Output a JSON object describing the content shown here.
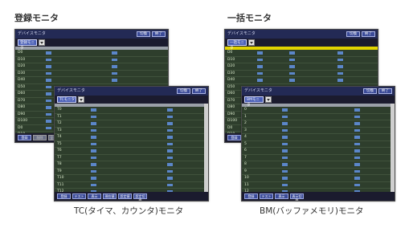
{
  "headings": {
    "registered": "登録モニタ",
    "batch": "一括モニタ"
  },
  "captions": {
    "tc": "TC(タイマ、カウンタ)モニタ",
    "bm": "BM(バッファメモリ)モニタ"
  },
  "window_titles": {
    "device_monitor": "デバイスモニタ"
  },
  "buttons": {
    "switch": "切換",
    "close": "終了"
  },
  "dropdowns": {
    "registered": "登録モニタ",
    "batch": "一括モニタ",
    "tc": "TCモニタ",
    "bm": "BMモニタ"
  },
  "footer_buttons": {
    "registered": [
      "登録",
      "削除",
      "全削除"
    ],
    "tc": [
      "登録",
      "テスト",
      "表示",
      "現在値",
      "設定値",
      "設定切換"
    ],
    "bm": [
      "登録",
      "テスト",
      "表示",
      "表示切換"
    ]
  },
  "row_labels": {
    "registered": [
      "D0",
      "D10",
      "D20",
      "D30",
      "D40",
      "D50",
      "D60",
      "D70",
      "D80",
      "D90",
      "D100"
    ],
    "tc": [
      "T0",
      "T1",
      "T2",
      "T3",
      "T4",
      "T5",
      "T6",
      "T7",
      "T8",
      "T9",
      "T10",
      "T11",
      "T12",
      "T13"
    ],
    "bm": [
      "0",
      "1",
      "2",
      "3",
      "4",
      "5",
      "6",
      "7",
      "8",
      "9",
      "10",
      "11",
      "12"
    ]
  },
  "colors": {
    "screen_bg": "#2e3e2c",
    "title_bar": "#232a55",
    "button": "#3b4b98",
    "value_cell": "#5b86c9",
    "highlight": "#e2d400"
  }
}
